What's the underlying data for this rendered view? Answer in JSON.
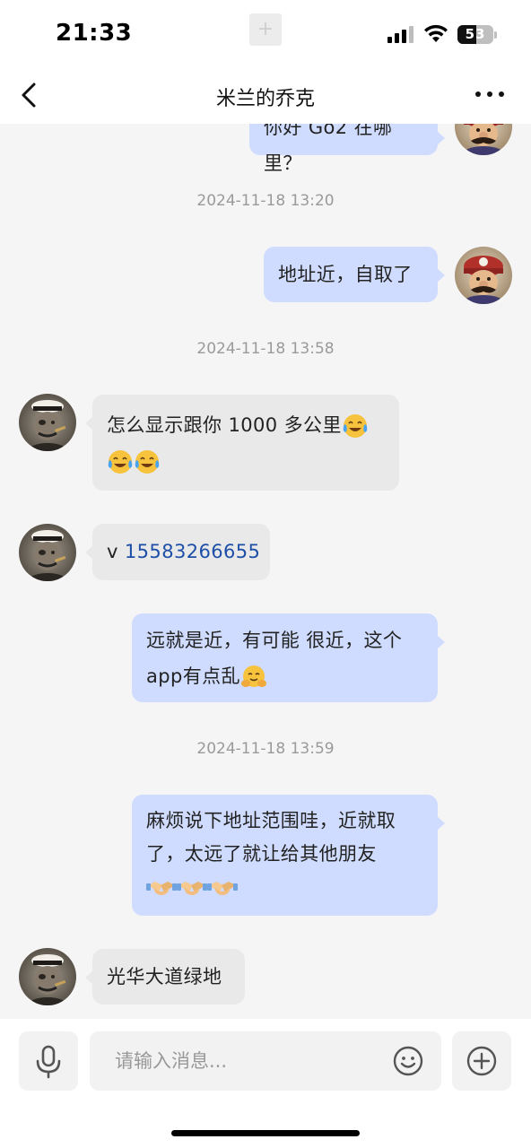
{
  "status_bar": {
    "time": "21:33",
    "plus_glyph": "+",
    "battery_level": "53"
  },
  "nav": {
    "title": "米兰的乔克",
    "back_icon": "chevron-left-icon",
    "more_icon": "more-dots-icon"
  },
  "messages": [
    {
      "side": "right",
      "text": "你好 Go2 在哪里？"
    },
    {
      "timestamp": "2024-11-18 13:20"
    },
    {
      "side": "right",
      "text": "地址近，自取了"
    },
    {
      "timestamp": "2024-11-18 13:58"
    },
    {
      "side": "left",
      "line1": "怎么显示跟你 1000 多公里",
      "emoji": "crying-laughing-emoji"
    },
    {
      "side": "left",
      "prefix": "v ",
      "phone": "15583266655"
    },
    {
      "side": "right",
      "line1": "远就是近，有可能 很近，这个",
      "line2": "app有点乱",
      "emoji": "hugging-emoji"
    },
    {
      "timestamp": "2024-11-18 13:59"
    },
    {
      "side": "right",
      "line1": "麻烦说下地址范围哇，近就取",
      "line2": "了，太远了就让给其他朋友",
      "emoji": "handshake-emoji"
    },
    {
      "side": "left",
      "text": "光华大道绿地"
    }
  ],
  "input": {
    "placeholder": "请输入消息..."
  },
  "colors": {
    "bubble_self": "#cfdcff",
    "bubble_other": "#e9e9e9",
    "link": "#1e4fa8",
    "background": "#f5f5f5"
  }
}
